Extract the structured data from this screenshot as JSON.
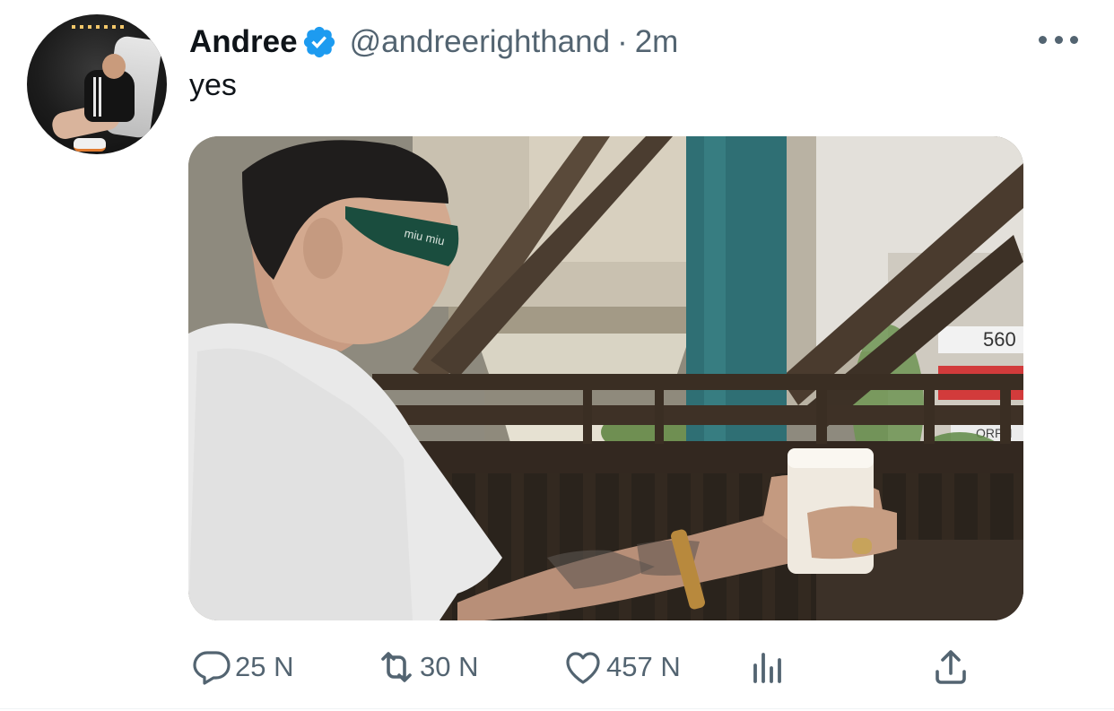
{
  "tweet": {
    "author_name": "Andree",
    "handle": "@andreerighthand",
    "separator": "·",
    "time": "2m",
    "text": "yes",
    "verified_icon": "verified-badge-icon",
    "more_icon": "more-horizontal-icon"
  },
  "media": {
    "frame_text": "miu miu",
    "sign_number": "560",
    "sign_fragment": "ORPH"
  },
  "actions": {
    "reply": {
      "icon": "reply-icon",
      "count": "25 N"
    },
    "retweet": {
      "icon": "retweet-icon",
      "count": "30 N"
    },
    "like": {
      "icon": "heart-icon",
      "count": "457 N"
    },
    "views": {
      "icon": "views-bar-chart-icon"
    },
    "share": {
      "icon": "share-icon"
    }
  },
  "colors": {
    "text_primary": "#0f1419",
    "text_secondary": "#536471",
    "verified_blue": "#1d9bf0"
  }
}
